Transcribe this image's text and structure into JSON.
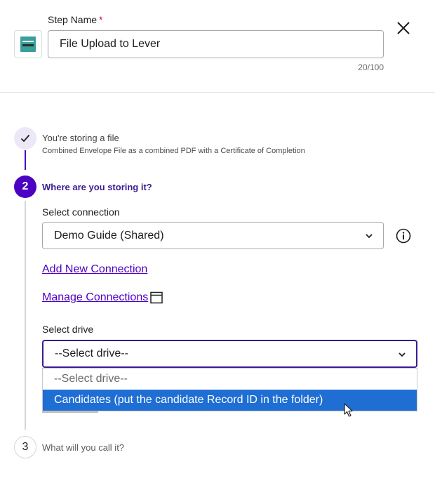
{
  "header": {
    "step_name_label": "Step Name",
    "required_mark": "*",
    "step_name_value": "File Upload to Lever",
    "char_counter": "20/100",
    "logo_icon": "lever-logo-icon",
    "close_icon": "close-icon"
  },
  "steps": {
    "step1": {
      "title": "You're storing a file",
      "subtitle": "Combined Envelope File as a combined PDF with a Certificate of Completion",
      "status_icon": "checkmark-icon"
    },
    "step2": {
      "number": "2",
      "title": "Where are you storing it?"
    },
    "step3": {
      "number": "3",
      "title": "What will you call it?"
    }
  },
  "connection": {
    "label": "Select connection",
    "selected": "Demo Guide (Shared)",
    "info_icon": "info-icon",
    "add_link": "Add New Connection",
    "manage_link": "Manage Connections",
    "manage_icon": "external-window-icon"
  },
  "drive": {
    "label": "Select drive",
    "selected": "--Select drive--",
    "options": [
      "--Select drive--",
      "Candidates (put the candidate Record ID in the folder)"
    ]
  },
  "colors": {
    "accent": "#4c00c2",
    "accent_dark": "#3a1c91",
    "highlight": "#1f6ed4",
    "required": "#c8102e"
  }
}
